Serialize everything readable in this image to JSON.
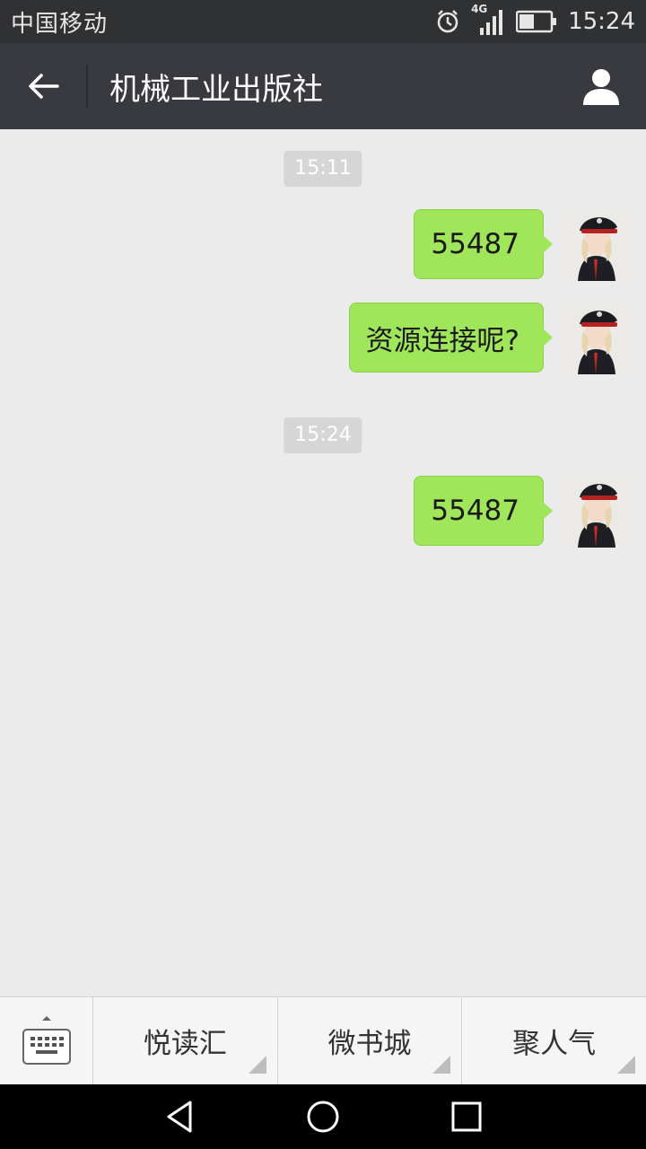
{
  "status_bar": {
    "carrier": "中国移动",
    "network": "4G",
    "time": "15:24",
    "icons": [
      "alarm-icon",
      "signal-icon",
      "battery-icon"
    ]
  },
  "header": {
    "title": "机械工业出版社",
    "back_icon": "back-arrow-icon",
    "profile_icon": "person-icon"
  },
  "chat": {
    "entries": [
      {
        "type": "time",
        "text": "15:11"
      },
      {
        "type": "message",
        "sender": "me",
        "text": "55487"
      },
      {
        "type": "message",
        "sender": "me",
        "text": "资源连接呢?"
      },
      {
        "type": "time",
        "text": "15:24"
      },
      {
        "type": "message",
        "sender": "me",
        "text": "55487"
      }
    ]
  },
  "bottom_menu": {
    "keyboard_icon": "keyboard-icon",
    "items": [
      {
        "label": "悦读汇"
      },
      {
        "label": "微书城"
      },
      {
        "label": "聚人气"
      }
    ]
  },
  "nav_bar": {
    "icons": [
      "back-triangle-icon",
      "home-circle-icon",
      "recents-square-icon"
    ]
  },
  "colors": {
    "bubble": "#9fe65a",
    "header_bg": "#393a3f",
    "status_bg": "#2f3133",
    "chat_bg": "#ebebeb"
  }
}
